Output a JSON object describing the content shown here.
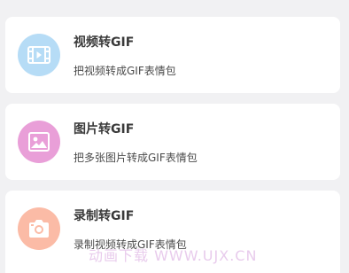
{
  "colors": {
    "background": "#f1f1f3",
    "card": "#ffffff",
    "video_icon_bg": "#b6dcf6",
    "image_icon_bg": "#e99fd8",
    "camera_icon_bg": "#fbbba6"
  },
  "items": [
    {
      "title": "视频转GIF",
      "subtitle": "把视频转成GIF表情包",
      "icon": "video-icon"
    },
    {
      "title": "图片转GIF",
      "subtitle": "把多张图片转成GIF表情包",
      "icon": "image-icon"
    },
    {
      "title": "录制转GIF",
      "subtitle": "录制视频转成GIF表情包",
      "icon": "camera-icon"
    }
  ],
  "watermark": "动画下载 WWW.UJX.CN"
}
